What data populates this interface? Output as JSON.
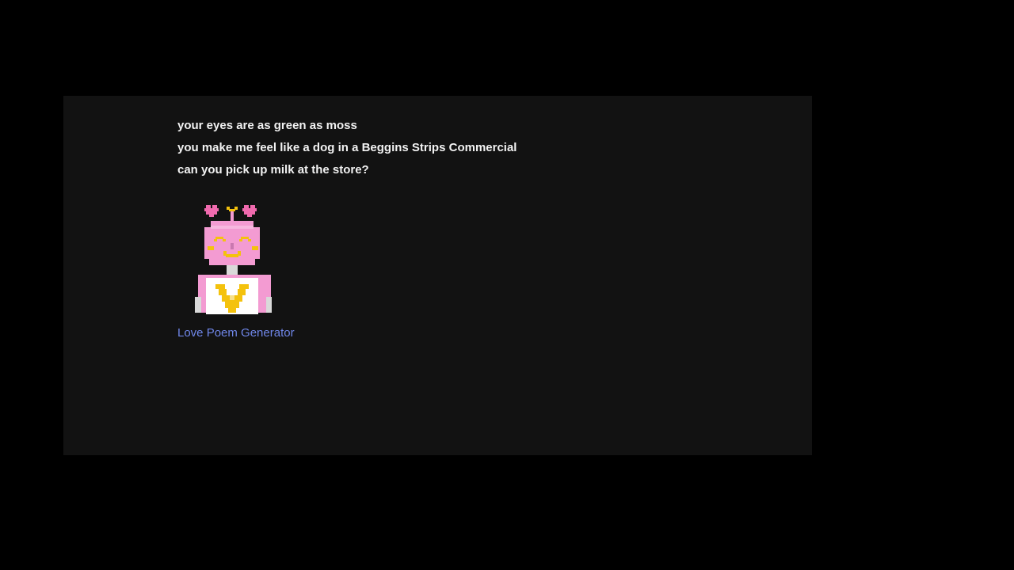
{
  "poem": {
    "lines": [
      "your eyes are as green as moss",
      "you make me feel like a dog in a Beggins Strips Commercial",
      "can you pick up milk at the store?"
    ]
  },
  "robot_image": {
    "icon": "pink-robot-with-hearts-icon"
  },
  "link": {
    "label": "Love Poem Generator"
  },
  "colors": {
    "page_background": "#000000",
    "panel_background": "#121212",
    "poem_text": "#f2f2f2",
    "link": "#6f86e8",
    "robot_pink": "#f39bd2",
    "robot_yellow": "#f4c20d",
    "heart_pink": "#f06aae"
  }
}
